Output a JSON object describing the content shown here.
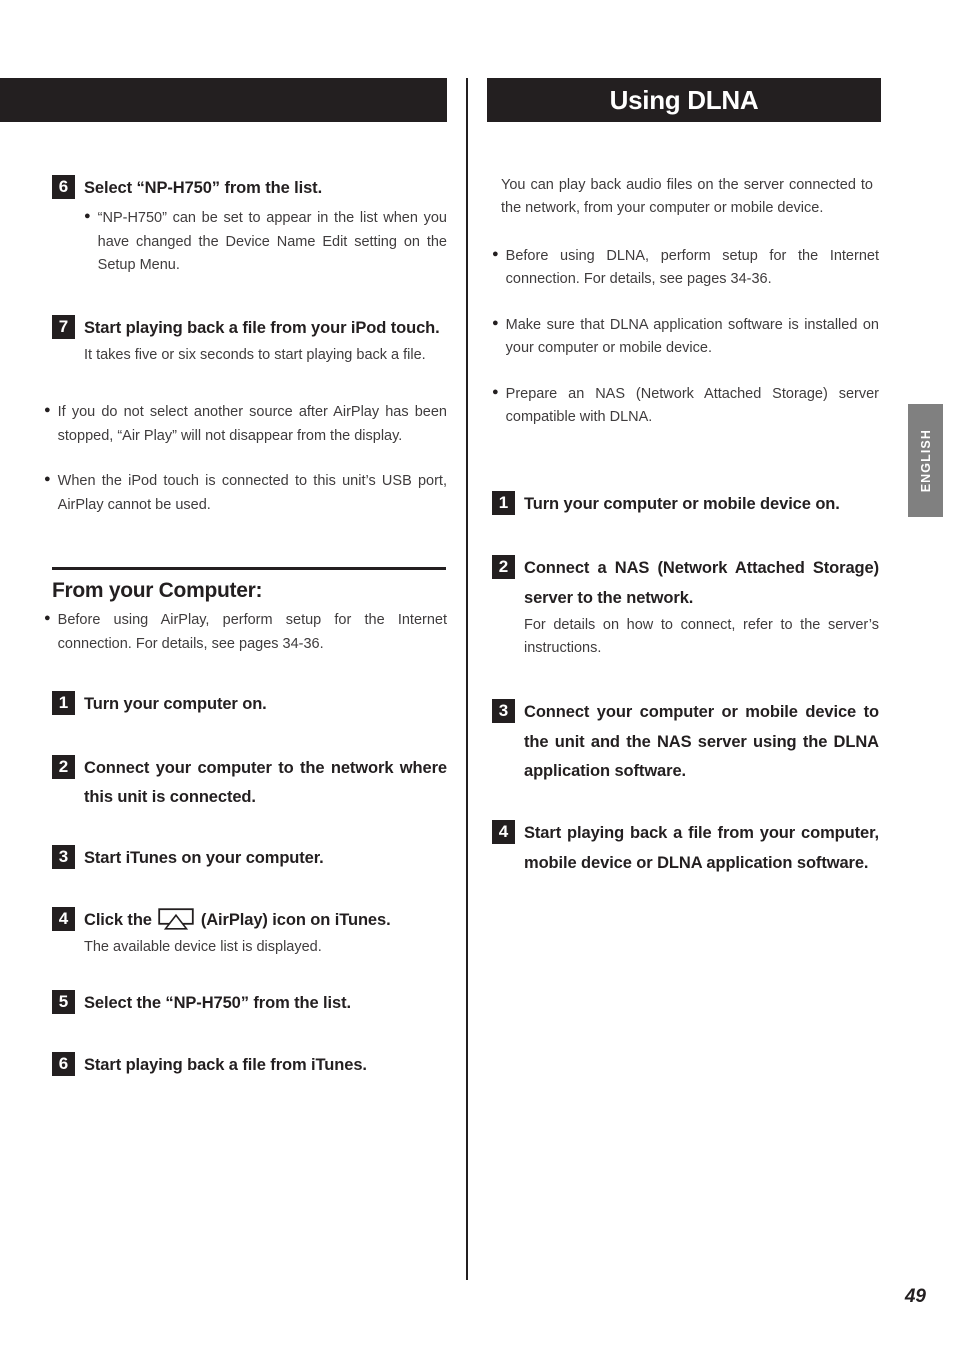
{
  "page": {
    "number": "49",
    "side_tab_label": "ENGLISH"
  },
  "left_column": {
    "header_bar_title": "",
    "steps_airplay_ipod": [
      {
        "number": "6",
        "title": "Select “NP-H750” from the list.",
        "sub_bullets": [
          "“NP-H750” can be set to appear in the list when you have changed the Device Name Edit setting on the Setup Menu."
        ]
      },
      {
        "number": "7",
        "title": "Start playing back a file from your iPod touch.",
        "note": "It takes five or six seconds to start playing back a file."
      }
    ],
    "notes_bullets": [
      "If you do not select another source after AirPlay has been stopped, “Air Play” will not disappear from the display.",
      "When the iPod touch is connected to this unit’s USB port, AirPlay cannot be used."
    ],
    "section": {
      "title": "From your Computer:",
      "bullets": [
        "Before using AirPlay, perform setup for the Internet connection. For details, see pages 34-36."
      ],
      "steps": [
        {
          "number": "1",
          "title": "Turn your computer on."
        },
        {
          "number": "2",
          "title": "Connect your computer to the network where this unit is connected."
        },
        {
          "number": "3",
          "title": "Start iTunes on your computer."
        },
        {
          "number": "4",
          "title_before_icon": "Click the",
          "icon": "airplay-icon",
          "title_after_icon": "(AirPlay) icon on iTunes.",
          "note": "The available device list is displayed."
        },
        {
          "number": "5",
          "title": "Select the “NP-H750” from the list."
        },
        {
          "number": "6",
          "title": "Start playing back a file from iTunes."
        }
      ]
    }
  },
  "right_column": {
    "header_bar_title": "Using DLNA",
    "intro": "You can play back audio files on the server connected to the network, from your computer or mobile device.",
    "bullets": [
      "Before using DLNA, perform setup for the Internet connection. For details, see pages 34-36.",
      "Make sure that DLNA application software is installed on your computer or mobile device.",
      "Prepare an NAS (Network Attached Storage) server compatible with DLNA."
    ],
    "steps": [
      {
        "number": "1",
        "title": "Turn your computer or mobile device on."
      },
      {
        "number": "2",
        "title": "Connect a NAS (Network Attached Storage) server to the network.",
        "note": "For details on how to connect, refer to the server’s instructions."
      },
      {
        "number": "3",
        "title": "Connect your computer or mobile device to the unit and the NAS server using the DLNA application software."
      },
      {
        "number": "4",
        "title": "Start playing back a file from your computer, mobile device or DLNA application software."
      }
    ]
  },
  "colors": {
    "ink": "#231f20",
    "body_gray": "#3f3c3d",
    "tab_gray": "#808080"
  }
}
